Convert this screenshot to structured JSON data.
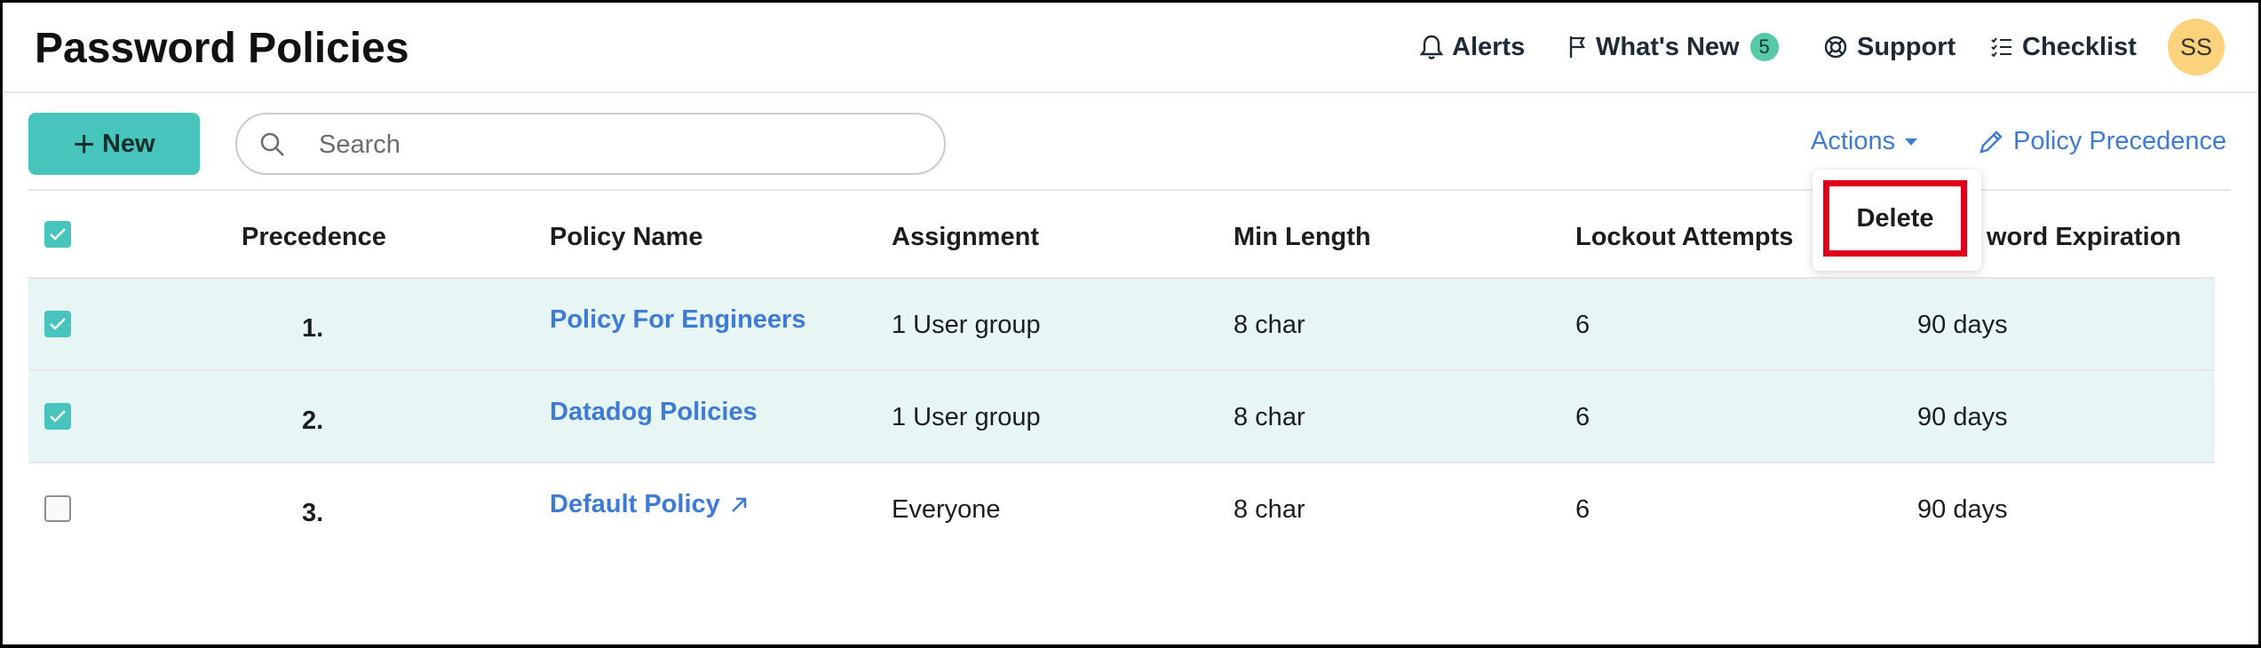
{
  "header": {
    "title": "Password Policies",
    "nav": {
      "alerts": "Alerts",
      "whats_new": "What's New",
      "whats_new_count": "5",
      "support": "Support",
      "checklist": "Checklist"
    },
    "avatar_initials": "SS"
  },
  "toolbar": {
    "new_label": "New",
    "search_placeholder": "Search",
    "actions_label": "Actions",
    "policy_precedence_label": "Policy Precedence"
  },
  "dropdown": {
    "items": [
      "Delete"
    ]
  },
  "table": {
    "columns": [
      "Precedence",
      "Policy Name",
      "Assignment",
      "Min Length",
      "Lockout Attempts",
      "Password Expiration"
    ],
    "column_partial": "word Expiration",
    "rows": [
      {
        "checked": true,
        "precedence": "1.",
        "name": "Policy For Engineers",
        "assignment": "1 User group",
        "min_length": "8 char",
        "lockout": "6",
        "expiration": "90 days"
      },
      {
        "checked": true,
        "precedence": "2.",
        "name": "Datadog Policies",
        "assignment": "1 User group",
        "min_length": "8 char",
        "lockout": "6",
        "expiration": "90 days"
      },
      {
        "checked": false,
        "precedence": "3.",
        "name": "Default Policy",
        "assignment": "Everyone",
        "min_length": "8 char",
        "lockout": "6",
        "expiration": "90 days"
      }
    ]
  },
  "colors": {
    "accent": "#47c5bd",
    "link": "#3e7bd6",
    "selected_row": "#e7f6f5",
    "highlight": "#e0001a",
    "avatar": "#fcd37c",
    "badge": "#56c9a7"
  },
  "icons": [
    "bell-icon",
    "flag-icon",
    "lifebuoy-icon",
    "checklist-icon",
    "plus-icon",
    "search-icon",
    "caret-down-icon",
    "pencil-icon",
    "check-icon",
    "external-link-icon"
  ]
}
